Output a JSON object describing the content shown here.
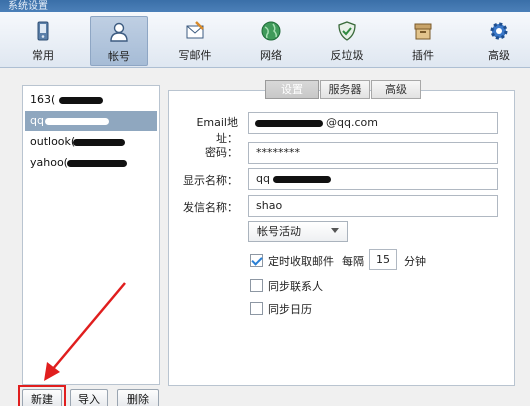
{
  "window": {
    "title": "系统设置"
  },
  "toolbar": {
    "items": [
      {
        "label": "常用"
      },
      {
        "label": "帐号"
      },
      {
        "label": "写邮件"
      },
      {
        "label": "网络"
      },
      {
        "label": "反垃圾"
      },
      {
        "label": "插件"
      },
      {
        "label": "高级"
      }
    ],
    "active": "帐号"
  },
  "accounts": {
    "items": [
      {
        "label": "163("
      },
      {
        "label": "qq"
      },
      {
        "label": "outlook("
      },
      {
        "label": "yahoo("
      }
    ],
    "selected_index": 1
  },
  "list_buttons": {
    "new": "新建",
    "import": "导入",
    "delete": "删除"
  },
  "tabs": [
    {
      "label": "设置"
    },
    {
      "label": "服务器"
    },
    {
      "label": "高级"
    }
  ],
  "form": {
    "email_label": "Email地址：",
    "email_value": "@qq.com",
    "password_label": "密码：",
    "password_value": "********",
    "display_name_label": "显示名称：",
    "display_name_value": "qq",
    "sender_name_label": "发信名称：",
    "sender_name_value": "shao",
    "account_status": "帐号活动",
    "auto_receive_label": "定时收取邮件",
    "interval_prefix": "每隔",
    "interval_value": "15",
    "interval_unit": "分钟",
    "sync_contacts_label": "同步联系人",
    "sync_calendar_label": "同步日历",
    "auto_receive_checked": true,
    "sync_contacts_checked": false,
    "sync_calendar_checked": false
  },
  "colors": {
    "accent": "#2a7fd4",
    "selection": "#8fa7bf",
    "annotation": "#e01e1e"
  }
}
